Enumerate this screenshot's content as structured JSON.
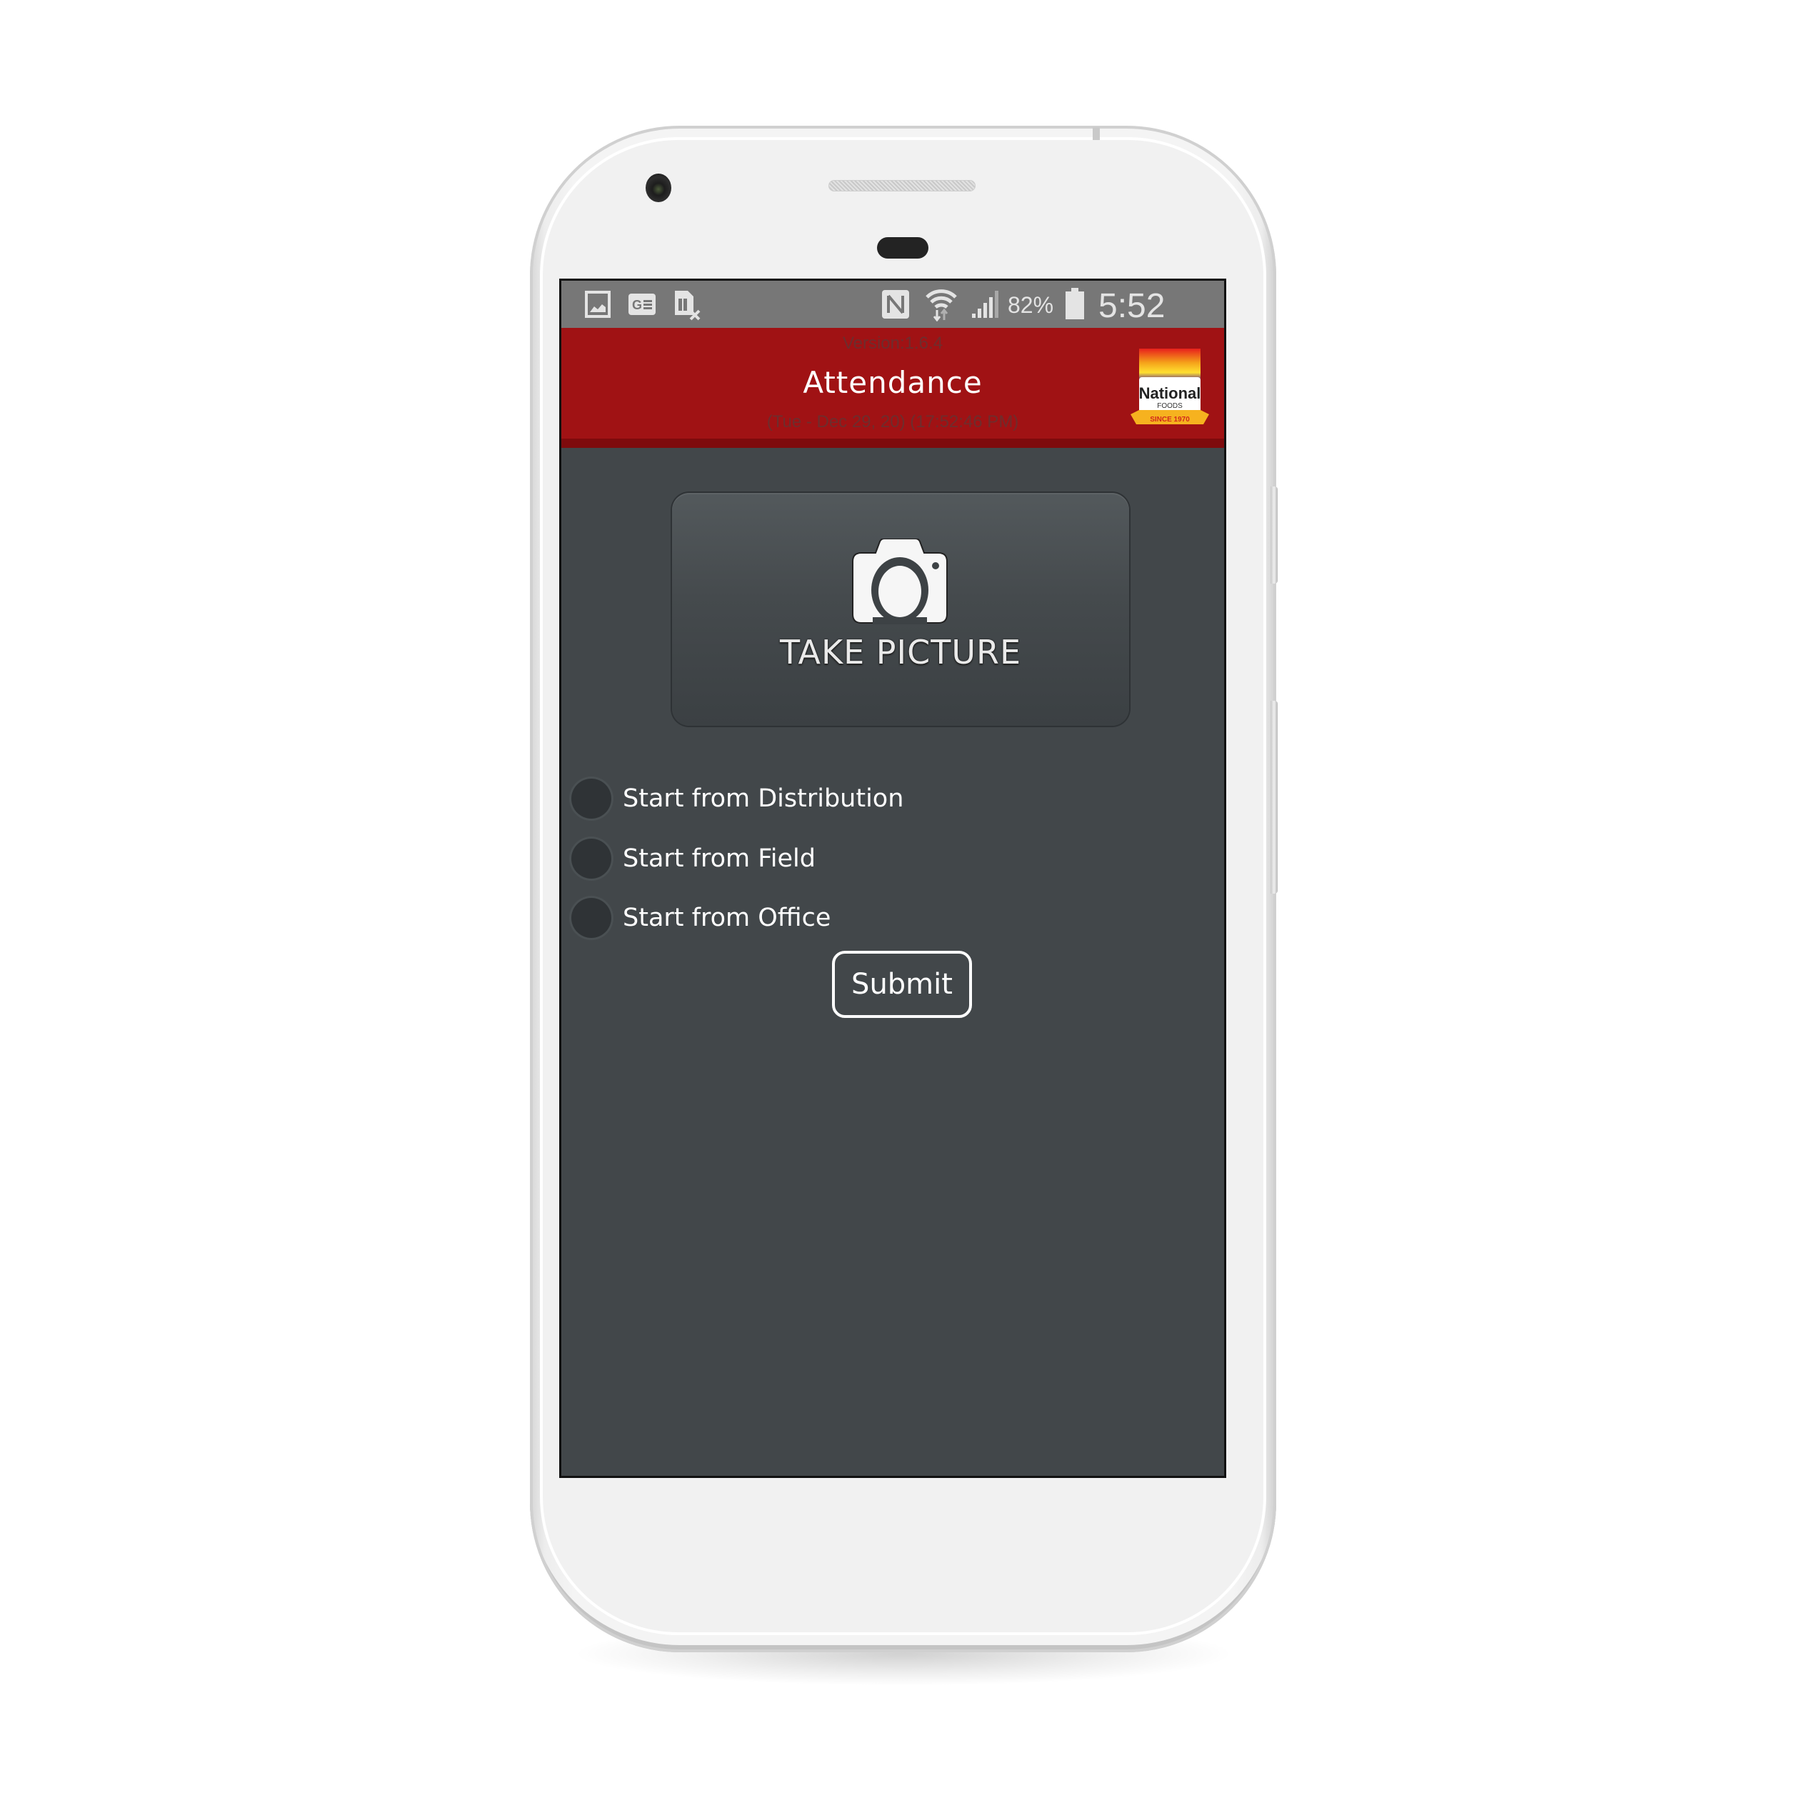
{
  "status_bar": {
    "left_icons": [
      "gallery-icon",
      "google-news-icon",
      "no-sim-icon"
    ],
    "right_icons": [
      "nfc-icon",
      "wifi-icon",
      "signal-icon",
      "battery-icon"
    ],
    "battery_percent": "82%",
    "time": "5:52 PM"
  },
  "header": {
    "version": "Version:1.6.4",
    "title": "Attendance",
    "datetime": "(Tue - Dec 29, 20) (17:52:46 PM)",
    "logo": {
      "brand": "National",
      "sub": "FOODS",
      "tagline": "SINCE 1970"
    }
  },
  "main": {
    "take_picture_label": "TAKE PICTURE",
    "options": [
      {
        "label": "Start from Distribution",
        "selected": false
      },
      {
        "label": "Start from Field",
        "selected": false
      },
      {
        "label": "Start from Office",
        "selected": false
      }
    ],
    "submit_label": "Submit"
  },
  "colors": {
    "header_red": "#a01214",
    "header_stripe": "#7e0b0d",
    "content_bg": "#42474a",
    "status_bar": "#777777"
  }
}
